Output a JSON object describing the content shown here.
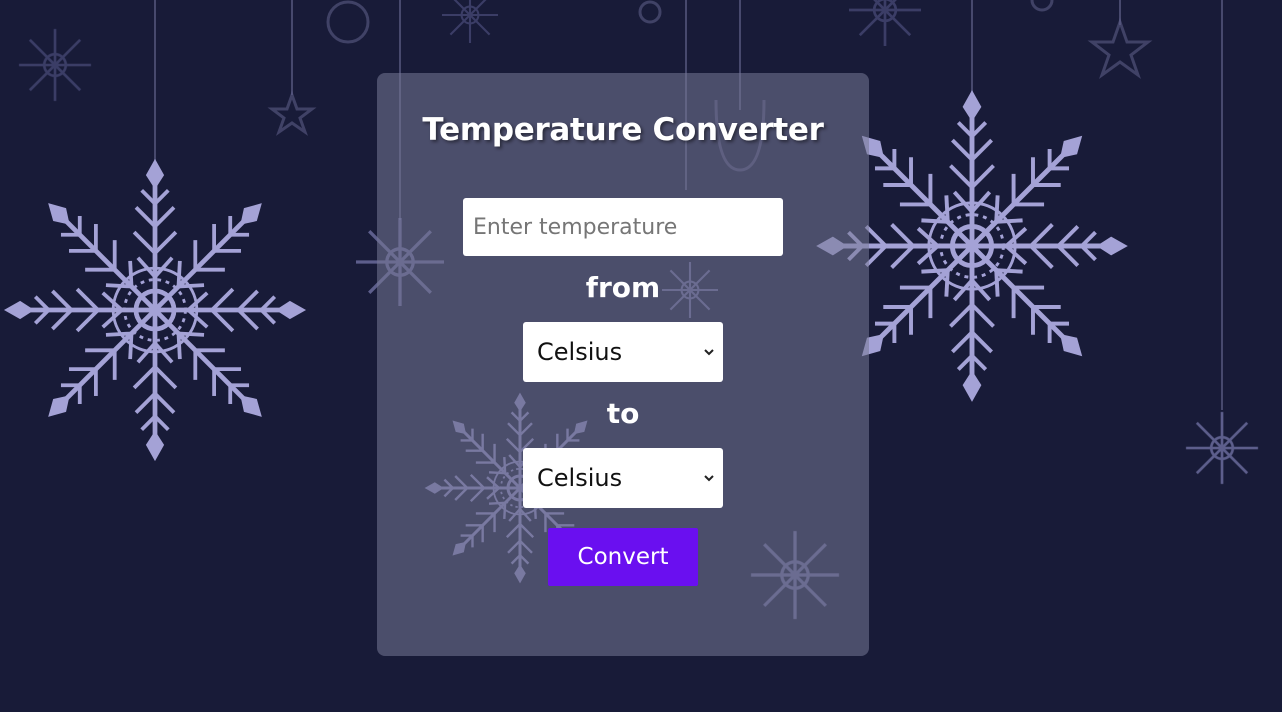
{
  "app": {
    "title": "Temperature Converter"
  },
  "form": {
    "temperature_input": {
      "value": "",
      "placeholder": "Enter temperature"
    },
    "from_label": "from",
    "from_unit": {
      "selected": "Celsius"
    },
    "to_label": "to",
    "to_unit": {
      "selected": "Celsius"
    },
    "convert_label": "Convert"
  },
  "colors": {
    "background": "#181b38",
    "card": "#5a5c78",
    "accent": "#6a0ff0",
    "snowflake": "#a4a2d6"
  },
  "icons": {
    "select_arrow": "chevron-down-icon",
    "decoration": "snowflake-icon"
  }
}
